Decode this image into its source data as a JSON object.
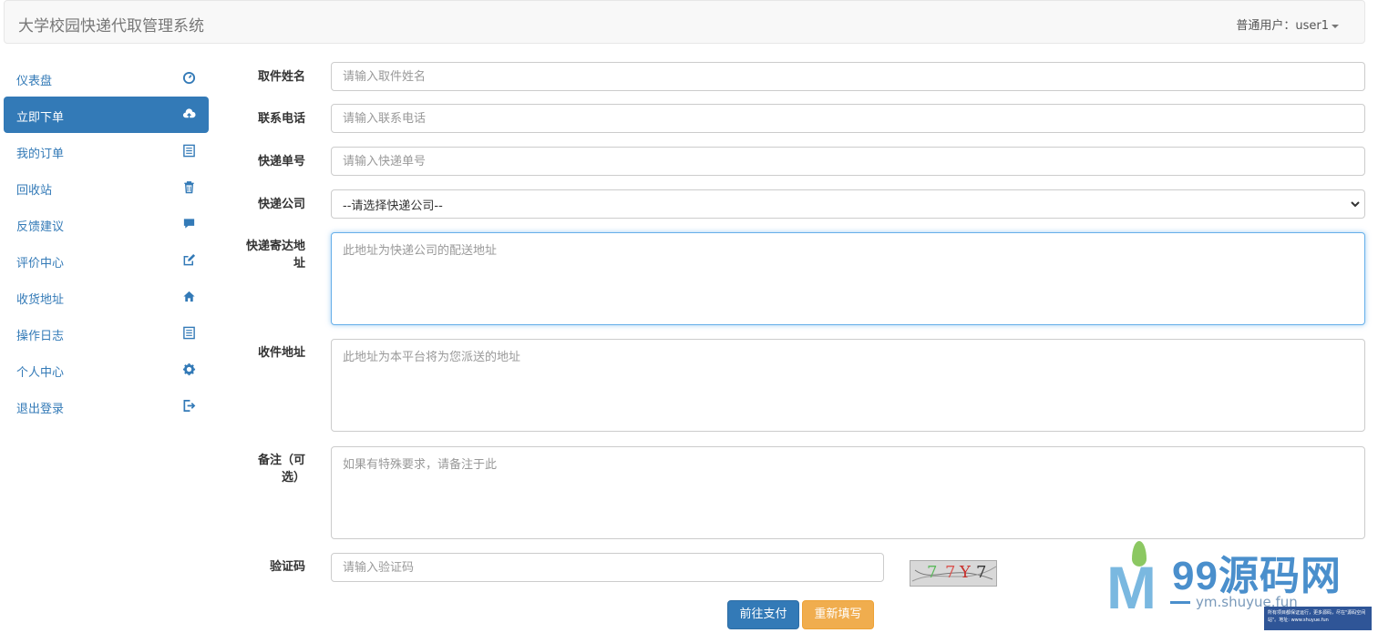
{
  "header": {
    "title": "大学校园快递代取管理系统",
    "user_label": "普通用户：user1"
  },
  "sidebar": {
    "items": [
      {
        "label": "仪表盘",
        "icon": "dashboard-icon"
      },
      {
        "label": "立即下单",
        "icon": "cloud-upload-icon",
        "active": true
      },
      {
        "label": "我的订单",
        "icon": "list-alt-icon"
      },
      {
        "label": "回收站",
        "icon": "trash-icon"
      },
      {
        "label": "反馈建议",
        "icon": "comment-icon"
      },
      {
        "label": "评价中心",
        "icon": "edit-icon"
      },
      {
        "label": "收货地址",
        "icon": "home-icon"
      },
      {
        "label": "操作日志",
        "icon": "list-alt-icon"
      },
      {
        "label": "个人中心",
        "icon": "gear-icon"
      },
      {
        "label": "退出登录",
        "icon": "logout-icon"
      }
    ]
  },
  "form": {
    "name": {
      "label": "取件姓名",
      "placeholder": "请输入取件姓名"
    },
    "phone": {
      "label": "联系电话",
      "placeholder": "请输入联系电话"
    },
    "tracking": {
      "label": "快递单号",
      "placeholder": "请输入快递单号"
    },
    "company": {
      "label": "快递公司",
      "selected": "--请选择快递公司--"
    },
    "delivery_address": {
      "label_line1": "快递寄达地",
      "label_line2": "址",
      "placeholder": "此地址为快递公司的配送地址"
    },
    "receive_address": {
      "label": "收件地址",
      "placeholder": "此地址为本平台将为您派送的地址"
    },
    "remark": {
      "label_line1": "备注（可",
      "label_line2": "选）",
      "placeholder": "如果有特殊要求，请备注于此"
    },
    "captcha": {
      "label": "验证码",
      "placeholder": "请输入验证码",
      "image_text": [
        "7",
        "7",
        "Y",
        "7"
      ]
    }
  },
  "actions": {
    "pay_label": "前往支付",
    "reset_label": "重新填写"
  },
  "watermark": {
    "title": "99源码网",
    "url": "ym.shuyue.fun",
    "box_text": "所有项目都保证运行，更多源码，尽在\"源码空间站\"。地址: www.shuyue.fun"
  },
  "colors": {
    "primary": "#337ab7",
    "warning": "#f0ad4e",
    "navbar_bg": "#f8f8f8"
  }
}
